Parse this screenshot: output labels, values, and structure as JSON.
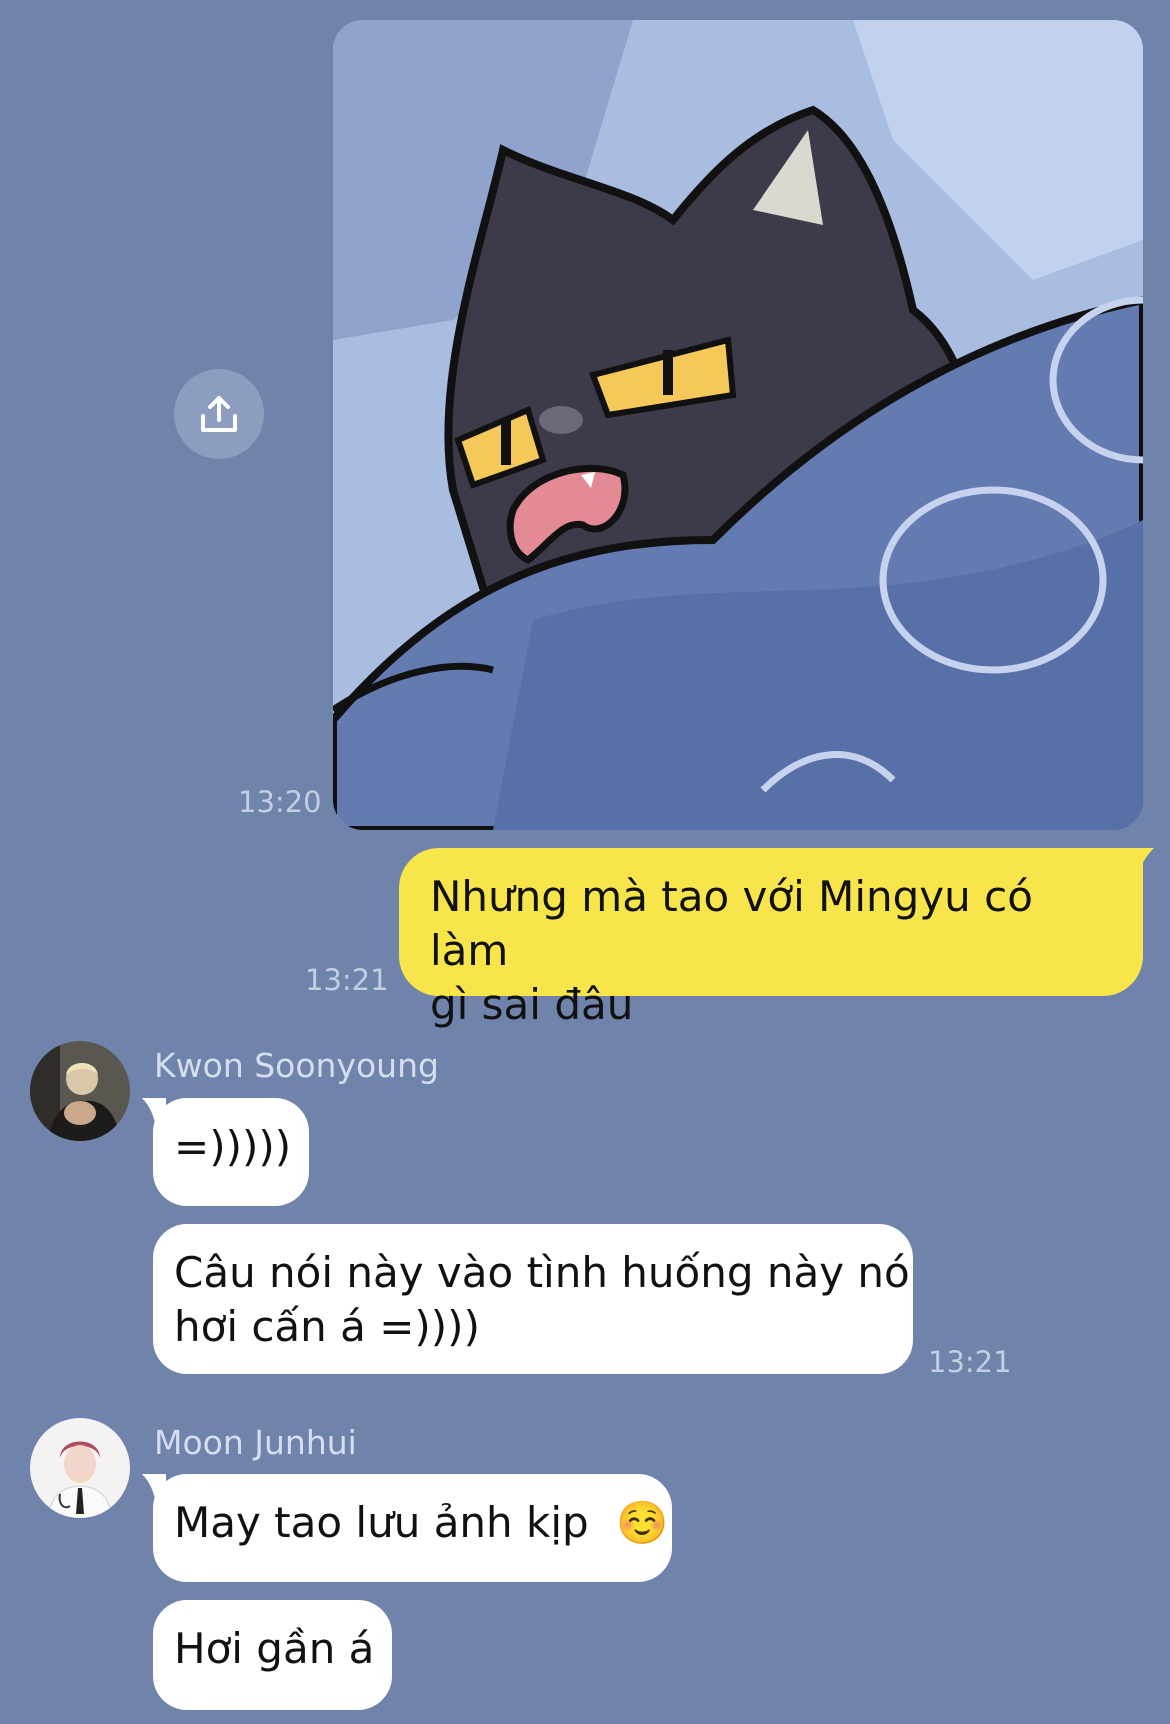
{
  "messages": {
    "sticker": {
      "time": "13:20",
      "share_icon": "share-upload-icon"
    },
    "outgoing_1": {
      "text_line1": "Nhưng mà tao với Mingyu có làm",
      "text_line2": "gì sai đâu",
      "time": "13:21"
    },
    "group_1": {
      "sender": "Kwon Soonyoung",
      "bubble_1": "=)))))",
      "bubble_2_line1": "Câu nói này vào tình huống này nó",
      "bubble_2_line2": "hơi cấn á =))))",
      "time": "13:21"
    },
    "group_2": {
      "sender": "Moon Junhui",
      "bubble_1": "May tao lưu ảnh kịp",
      "bubble_1_emoji": "☺️",
      "bubble_2": "Hơi gần á"
    }
  },
  "colors": {
    "background": "#7083ab",
    "outgoing_bubble": "#f8e54b",
    "incoming_bubble": "#ffffff"
  }
}
